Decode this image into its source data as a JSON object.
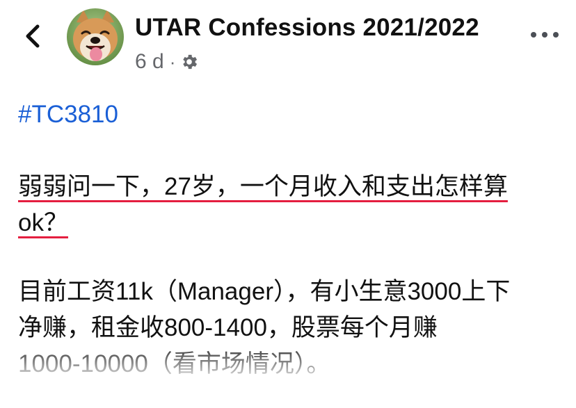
{
  "header": {
    "back_icon": "chevron-left-icon",
    "page_name": "UTAR Confessions 2021/2022",
    "time_ago": "6 d",
    "separator": "·",
    "privacy_icon": "gear-icon",
    "more_icon": "more-horizontal-icon"
  },
  "post": {
    "hashtag": "#TC3810",
    "question_line1": "弱弱问一下，27岁，一个月收入和支出怎样算",
    "question_line2": "ok？",
    "body_line1": "目前工资11k（Manager），有小生意3000上下",
    "body_line2": "净赚，租金收800-1400，股票每个月赚",
    "body_line3": "1000-10000（看市场情况）。"
  },
  "colors": {
    "hashtag": "#1a5fd6",
    "spellcheck_underline": "#e41e3f",
    "meta_text": "#65676b"
  }
}
